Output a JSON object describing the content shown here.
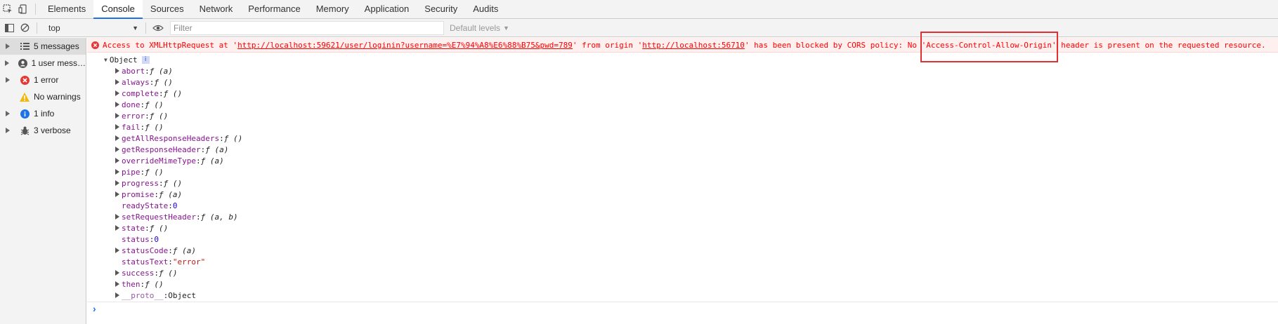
{
  "tabs": [
    "Elements",
    "Console",
    "Sources",
    "Network",
    "Performance",
    "Memory",
    "Application",
    "Security",
    "Audits"
  ],
  "active_tab": "Console",
  "toolbar": {
    "context": "top",
    "filter_placeholder": "Filter",
    "levels_label": "Default levels"
  },
  "sidebar": {
    "items": [
      {
        "label": "5 messages",
        "icon": "list-icon"
      },
      {
        "label": "1 user mess…",
        "icon": "user-icon"
      },
      {
        "label": "1 error",
        "icon": "error-icon"
      },
      {
        "label": "No warnings",
        "icon": "warning-icon"
      },
      {
        "label": "1 info",
        "icon": "info-icon"
      },
      {
        "label": "3 verbose",
        "icon": "bug-icon"
      }
    ]
  },
  "error": {
    "prefix": "Access to XMLHttpRequest at '",
    "url1": "http://localhost:59621/user/loginin?username=%E7%94%A8%E6%88%B75&pwd=789",
    "middle": "' from origin '",
    "url2": "http://localhost:56710",
    "suffix": "' has been blocked by CORS policy: No 'Access-Control-Allow-Origin' header is present on the requested resource."
  },
  "object": {
    "label": "Object",
    "info_badge": "i",
    "properties": [
      {
        "key": "abort",
        "value": "ƒ (a)",
        "type": "fn",
        "expandable": true
      },
      {
        "key": "always",
        "value": "ƒ ()",
        "type": "fn",
        "expandable": true
      },
      {
        "key": "complete",
        "value": "ƒ ()",
        "type": "fn",
        "expandable": true
      },
      {
        "key": "done",
        "value": "ƒ ()",
        "type": "fn",
        "expandable": true
      },
      {
        "key": "error",
        "value": "ƒ ()",
        "type": "fn",
        "expandable": true
      },
      {
        "key": "fail",
        "value": "ƒ ()",
        "type": "fn",
        "expandable": true
      },
      {
        "key": "getAllResponseHeaders",
        "value": "ƒ ()",
        "type": "fn",
        "expandable": true
      },
      {
        "key": "getResponseHeader",
        "value": "ƒ (a)",
        "type": "fn",
        "expandable": true
      },
      {
        "key": "overrideMimeType",
        "value": "ƒ (a)",
        "type": "fn",
        "expandable": true
      },
      {
        "key": "pipe",
        "value": "ƒ ()",
        "type": "fn",
        "expandable": true
      },
      {
        "key": "progress",
        "value": "ƒ ()",
        "type": "fn",
        "expandable": true
      },
      {
        "key": "promise",
        "value": "ƒ (a)",
        "type": "fn",
        "expandable": true
      },
      {
        "key": "readyState",
        "value": "0",
        "type": "num",
        "expandable": false
      },
      {
        "key": "setRequestHeader",
        "value": "ƒ (a, b)",
        "type": "fn",
        "expandable": true
      },
      {
        "key": "state",
        "value": "ƒ ()",
        "type": "fn",
        "expandable": true
      },
      {
        "key": "status",
        "value": "0",
        "type": "num",
        "expandable": false
      },
      {
        "key": "statusCode",
        "value": "ƒ (a)",
        "type": "fn",
        "expandable": true
      },
      {
        "key": "statusText",
        "value": "\"error\"",
        "type": "str",
        "expandable": false
      },
      {
        "key": "success",
        "value": "ƒ ()",
        "type": "fn",
        "expandable": true
      },
      {
        "key": "then",
        "value": "ƒ ()",
        "type": "fn",
        "expandable": true
      },
      {
        "key": "__proto__",
        "value": "Object",
        "type": "obj",
        "expandable": true
      }
    ]
  },
  "prompt_symbol": "›",
  "colors": {
    "error_text": "#ff0000",
    "error_bg": "#fff0f0",
    "accent": "#1a73e8",
    "highlight_box": "#e03030"
  }
}
